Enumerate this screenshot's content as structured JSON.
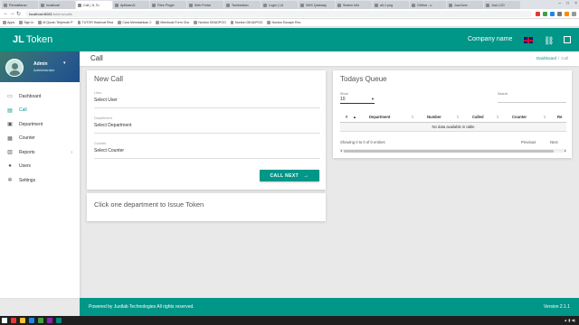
{
  "browser": {
    "tabs": [
      {
        "label": "Pendaftaran"
      },
      {
        "label": "localhost/"
      },
      {
        "label": "Call | JL To"
      },
      {
        "label": "Aplikasi Ai"
      },
      {
        "label": "Files Plugin"
      },
      {
        "label": "Web Portal"
      },
      {
        "label": "Tambahkan"
      },
      {
        "label": "Login | LA"
      },
      {
        "label": "SMS Qateway"
      },
      {
        "label": "Sistem Info"
      },
      {
        "label": "alt-1.png"
      },
      {
        "label": "GitHub - u"
      },
      {
        "label": "Jual Acer"
      },
      {
        "label": "Jual LCD"
      }
    ],
    "url_host": "localhost:8081",
    "url_path": "/tokens/calls",
    "bookmarks": [
      {
        "label": "Apps"
      },
      {
        "label": "Sign in"
      },
      {
        "label": "Al Quran Terjemah P"
      },
      {
        "label": "TUTOR Hashcat Reci"
      },
      {
        "label": "Cara Memisahkan 2"
      },
      {
        "label": "Membuat Form Onc"
      },
      {
        "label": "Nonton DEADPOO"
      },
      {
        "label": "Nonton DEADPOO"
      },
      {
        "label": "Nonton Escape Rec"
      }
    ]
  },
  "header": {
    "brand_bold": "JL",
    "brand_rest": "Token",
    "company": "Company name"
  },
  "sidebar": {
    "user_name": "Admin",
    "user_role": "Administrator",
    "items": [
      {
        "label": "Dashboard"
      },
      {
        "label": "Call"
      },
      {
        "label": "Department"
      },
      {
        "label": "Counter"
      },
      {
        "label": "Reports"
      },
      {
        "label": "Users"
      },
      {
        "label": "Settings"
      }
    ]
  },
  "page": {
    "title": "Call",
    "breadcrumb_link": "Dashboard",
    "breadcrumb_sep": "/",
    "breadcrumb_current": "Call"
  },
  "call_form": {
    "title": "New Call",
    "user_label": "User",
    "user_value": "Select User",
    "department_label": "Department",
    "department_value": "Select Department",
    "counter_label": "Counter",
    "counter_value": "Select Counter",
    "call_button": "CALL NEXT"
  },
  "department_panel": {
    "title": "Click one department to Issue Token"
  },
  "queue": {
    "title": "Todays Queue",
    "show_label": "Show",
    "show_value": "10",
    "search_label": "Search",
    "columns": [
      "#",
      "Department",
      "Number",
      "Called",
      "Counter",
      "Re"
    ],
    "empty_message": "No data available in table",
    "info": "Showing 0 to 0 of 0 entries",
    "prev": "Previous",
    "next": "Next"
  },
  "footer": {
    "left": "Powered by Justlab Technologies All rights reserved.",
    "right": "Version 2.1.1"
  },
  "colors": {
    "primary": "#009688",
    "sidebar_bg": "#ffffff",
    "content_bg": "#e9e9e9"
  }
}
